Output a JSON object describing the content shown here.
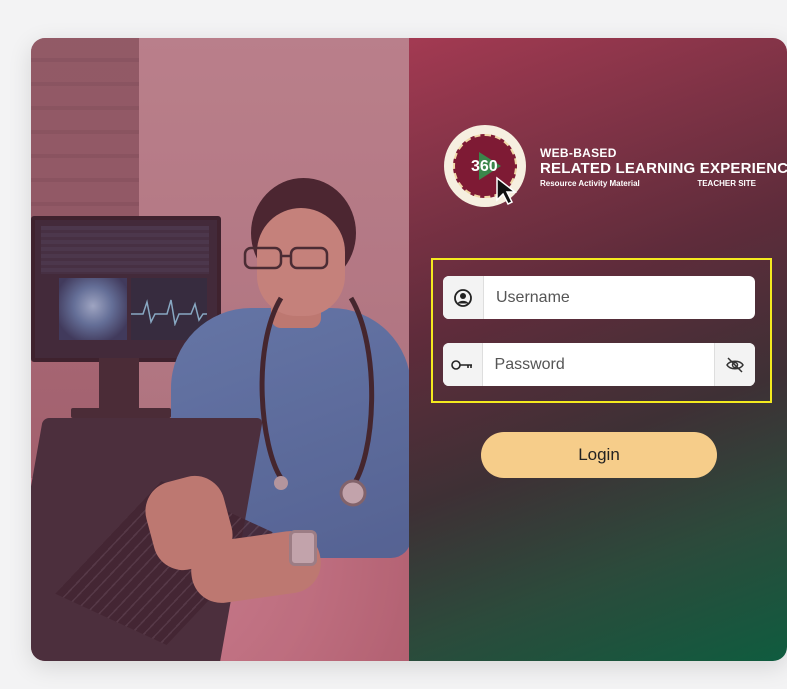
{
  "brand": {
    "line1": "WEB-BASED",
    "line2": "RELATED LEARNING EXPERIENCE",
    "line3_left": "Resource Activity Material",
    "line3_right": "TEACHER SITE",
    "logo_number": "360"
  },
  "form": {
    "username_placeholder": "Username",
    "password_placeholder": "Password",
    "login_label": "Login"
  },
  "colors": {
    "login_button": "#f6cd8a",
    "highlight_border": "#f4ea1f",
    "panel_top": "#a33a52",
    "panel_bottom": "#0f5c3f"
  },
  "icons": {
    "username": "user-circle-icon",
    "password": "key-icon",
    "toggle": "eye-off-icon"
  }
}
